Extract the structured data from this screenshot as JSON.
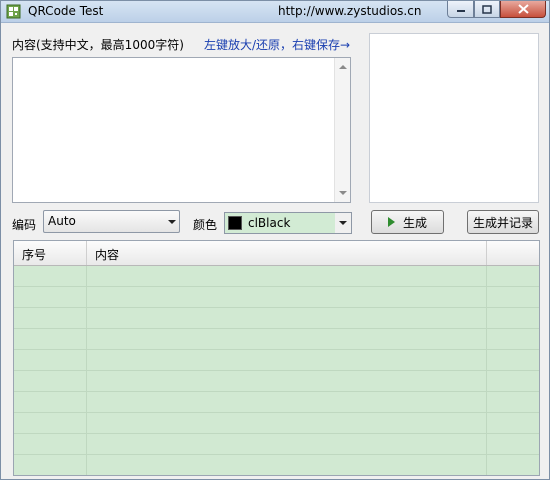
{
  "window": {
    "title": "QRCode Test",
    "url": "http://www.zystudios.cn"
  },
  "content": {
    "label": "内容(支持中文，最高1000字符)",
    "hint": "左键放大/还原，右键保存→",
    "text": ""
  },
  "encoding": {
    "label": "编码",
    "value": "Auto"
  },
  "color": {
    "label": "颜色",
    "value": "clBlack",
    "swatch": "#000000"
  },
  "buttons": {
    "generate": "生成",
    "generate_and_record": "生成并记录"
  },
  "grid": {
    "columns": [
      "序号",
      "内容",
      ""
    ],
    "rows": [
      [
        "",
        ""
      ],
      [
        "",
        ""
      ],
      [
        "",
        ""
      ],
      [
        "",
        ""
      ],
      [
        "",
        ""
      ],
      [
        "",
        ""
      ],
      [
        "",
        ""
      ],
      [
        "",
        ""
      ],
      [
        "",
        ""
      ],
      [
        "",
        ""
      ]
    ],
    "row_color": "#d1e9d2"
  }
}
